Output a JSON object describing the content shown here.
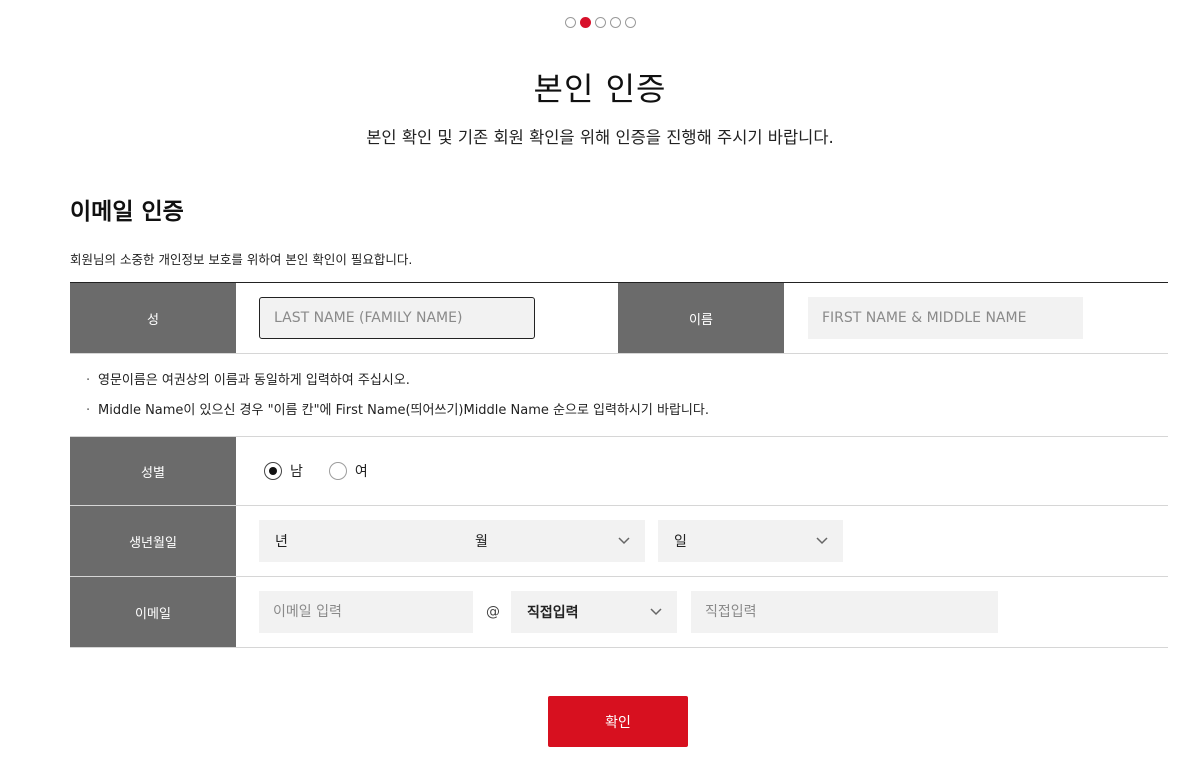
{
  "steps": {
    "total": 5,
    "current": 2
  },
  "header": {
    "title": "본인 인증",
    "subtitle": "본인 확인 및 기존 회원 확인을 위해 인증을 진행해 주시기 바랍니다."
  },
  "section": {
    "title": "이메일 인증",
    "description": "회원님의 소중한 개인정보 보호를 위하여 본인 확인이 필요합니다."
  },
  "form": {
    "last_name_label": "성",
    "last_name_placeholder": "LAST NAME (FAMILY NAME)",
    "first_name_label": "이름",
    "first_name_placeholder": "FIRST NAME & MIDDLE NAME",
    "notes": [
      "영문이름은 여권상의 이름과 동일하게 입력하여 주십시오.",
      "Middle Name이 있으신 경우 \"이름 칸\"에 First Name(띄어쓰기)Middle Name 순으로 입력하시기 바랍니다."
    ],
    "gender_label": "성별",
    "gender_options": [
      {
        "label": "남",
        "checked": true
      },
      {
        "label": "여",
        "checked": false
      }
    ],
    "birth_label": "생년월일",
    "birth_year": "년",
    "birth_month": "월",
    "birth_day": "일",
    "email_label": "이메일",
    "email_placeholder": "이메일 입력",
    "at_sign": "@",
    "domain_select": "직접입력",
    "domain_placeholder": "직접입력"
  },
  "confirm_button": "확인",
  "colors": {
    "accent": "#d7101f",
    "label_bg": "#6b6b6b",
    "input_bg": "#f2f2f2"
  }
}
